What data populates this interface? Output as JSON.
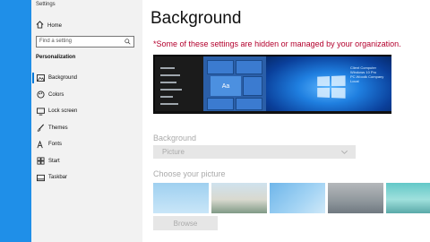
{
  "sidebar": {
    "app_title": "Settings",
    "home_label": "Home",
    "search_placeholder": "Find a setting",
    "section_title": "Personalization",
    "items": [
      {
        "label": "Background",
        "icon": "image-icon",
        "active": true
      },
      {
        "label": "Colors",
        "icon": "palette-icon",
        "active": false
      },
      {
        "label": "Lock screen",
        "icon": "lock-screen-icon",
        "active": false
      },
      {
        "label": "Themes",
        "icon": "brush-icon",
        "active": false
      },
      {
        "label": "Fonts",
        "icon": "font-icon",
        "active": false
      },
      {
        "label": "Start",
        "icon": "start-icon",
        "active": false
      },
      {
        "label": "Taskbar",
        "icon": "taskbar-icon",
        "active": false
      }
    ]
  },
  "main": {
    "title": "Background",
    "warning": "*Some of these settings are hidden or managed by your organization.",
    "preview": {
      "tile_text": "Aa",
      "org_text": "Client Computer Windows 10 Pro PC.Woodk Company Local"
    },
    "background_label": "Background",
    "background_value": "Picture",
    "choose_label": "Choose your picture",
    "browse_label": "Browse"
  },
  "colors": {
    "accent": "#0078d7",
    "sidebar_strip": "#1f8fe8",
    "warning": "#b3002d",
    "disabled_text": "#aaaaaa"
  }
}
